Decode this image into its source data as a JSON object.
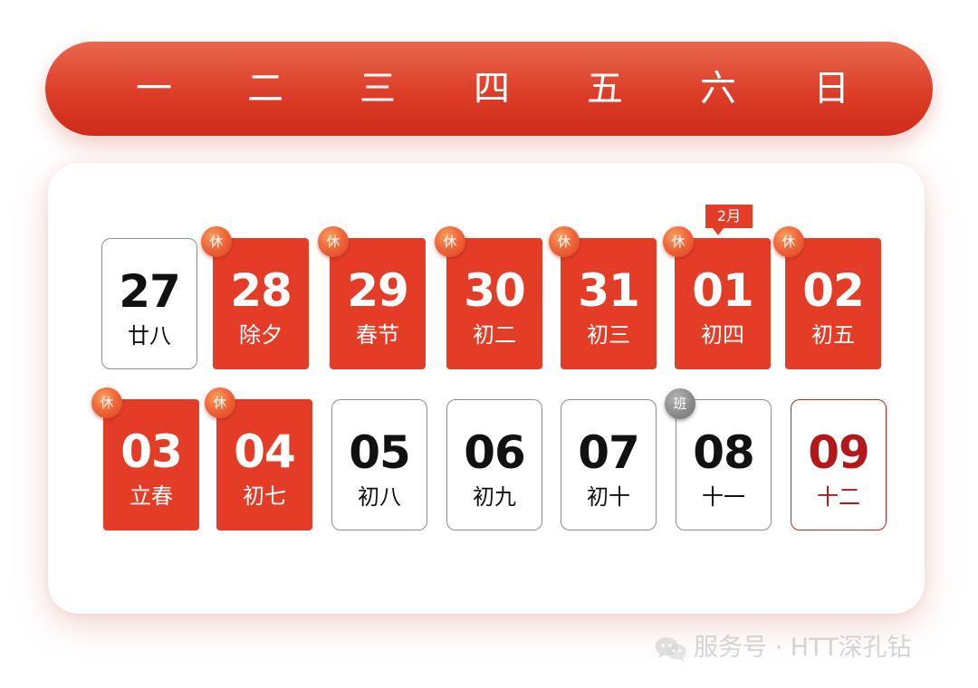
{
  "weekdays": [
    "一",
    "二",
    "三",
    "四",
    "五",
    "六",
    "日"
  ],
  "month_marker": "2月",
  "days": [
    {
      "date": "27",
      "lunar": "廿八",
      "style": "normal",
      "tag": ""
    },
    {
      "date": "28",
      "lunar": "除夕",
      "style": "holiday",
      "tag": "休"
    },
    {
      "date": "29",
      "lunar": "春节",
      "style": "holiday",
      "tag": "休"
    },
    {
      "date": "30",
      "lunar": "初二",
      "style": "holiday",
      "tag": "休"
    },
    {
      "date": "31",
      "lunar": "初三",
      "style": "holiday",
      "tag": "休"
    },
    {
      "date": "01",
      "lunar": "初四",
      "style": "holiday",
      "tag": "休"
    },
    {
      "date": "02",
      "lunar": "初五",
      "style": "holiday",
      "tag": "休"
    },
    {
      "date": "03",
      "lunar": "立春",
      "style": "holiday",
      "tag": "休"
    },
    {
      "date": "04",
      "lunar": "初七",
      "style": "holiday",
      "tag": "休"
    },
    {
      "date": "05",
      "lunar": "初八",
      "style": "normal",
      "tag": ""
    },
    {
      "date": "06",
      "lunar": "初九",
      "style": "normal",
      "tag": ""
    },
    {
      "date": "07",
      "lunar": "初十",
      "style": "normal",
      "tag": ""
    },
    {
      "date": "08",
      "lunar": "十一",
      "style": "normal",
      "tag": "班"
    },
    {
      "date": "09",
      "lunar": "十二",
      "style": "end",
      "tag": ""
    }
  ],
  "watermark": "服务号 · HTT深孔钻",
  "colors": {
    "accent": "#e43d27",
    "highlight": "#b3191a",
    "work_tag": "#8c8c8c"
  },
  "icons": {
    "watermark": "wechat-icon"
  }
}
